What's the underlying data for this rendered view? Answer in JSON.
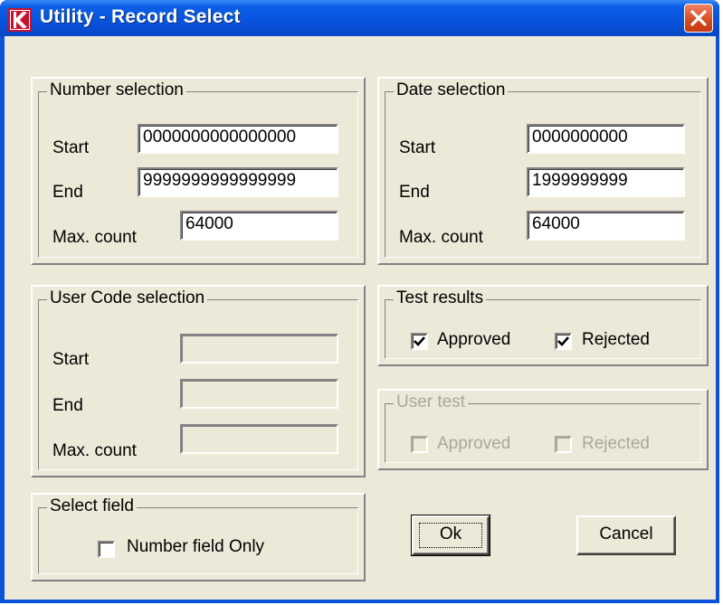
{
  "window": {
    "title": "Utility - Record Select",
    "icon": "k-logo-icon",
    "close_icon": "close-icon"
  },
  "number_selection": {
    "legend": "Number selection",
    "start_label": "Start",
    "start_value": "0000000000000000",
    "end_label": "End",
    "end_value": "9999999999999999",
    "max_label": "Max. count",
    "max_value": "64000"
  },
  "date_selection": {
    "legend": "Date selection",
    "start_label": "Start",
    "start_value": "0000000000",
    "end_label": "End",
    "end_value": "1999999999",
    "max_label": "Max. count",
    "max_value": "64000"
  },
  "user_code_selection": {
    "legend": "User Code selection",
    "start_label": "Start",
    "start_value": "",
    "end_label": "End",
    "end_value": "",
    "max_label": "Max. count",
    "max_value": ""
  },
  "test_results": {
    "legend": "Test results",
    "approved_label": "Approved",
    "approved_checked": true,
    "rejected_label": "Rejected",
    "rejected_checked": true
  },
  "user_test": {
    "legend": "User test",
    "approved_label": "Approved",
    "approved_checked": false,
    "rejected_label": "Rejected",
    "rejected_checked": false,
    "enabled": false
  },
  "select_field": {
    "legend": "Select field",
    "number_only_label": "Number field Only",
    "number_only_checked": false
  },
  "buttons": {
    "ok_label": "Ok",
    "cancel_label": "Cancel"
  },
  "colors": {
    "titlebar": "#0952dc",
    "dialog_face": "#ece9d8",
    "close_button": "#d74d23",
    "disabled_text": "#aca899"
  }
}
